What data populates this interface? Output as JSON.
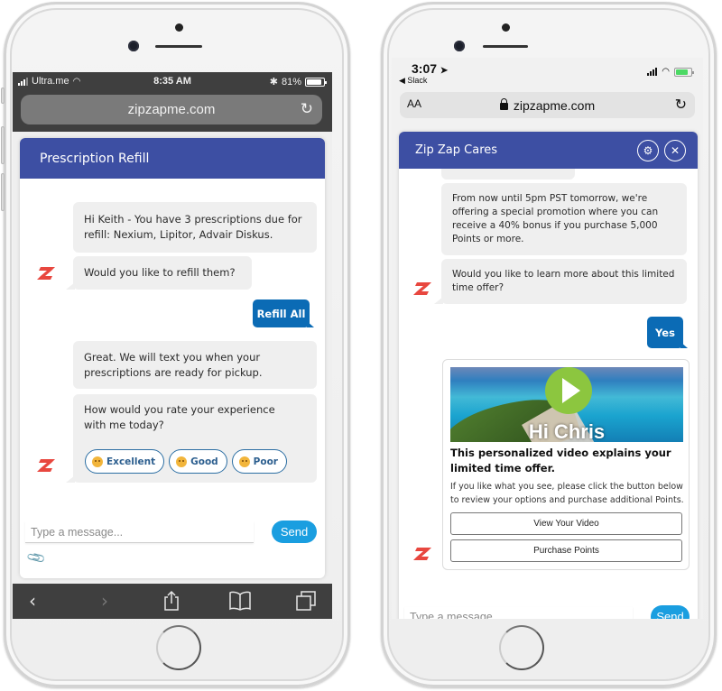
{
  "left_phone": {
    "status_bar": {
      "carrier": "Ultra.me",
      "time": "8:35 AM",
      "battery_percent": "81%",
      "battery_level": 0.81
    },
    "browser": {
      "url": "zipzapme.com",
      "reload_icon": "reload-icon"
    },
    "chat": {
      "title": "Prescription Refill",
      "messages": [
        {
          "from": "bot",
          "text": "Hi Keith - You have 3 prescriptions due for refill: Nexium, Lipitor, Advair Diskus."
        },
        {
          "from": "bot",
          "text": "Would you like to refill them?"
        },
        {
          "from": "user",
          "text": "Refill All"
        },
        {
          "from": "bot",
          "text": "Great. We will text you when your prescriptions are ready for pickup."
        },
        {
          "from": "bot",
          "text": "How would you rate your experience with me today?"
        }
      ],
      "rating_options": [
        {
          "label": "Excellent",
          "icon": "happy-face-icon"
        },
        {
          "label": "Good",
          "icon": "neutral-face-icon"
        },
        {
          "label": "Poor",
          "icon": "sad-face-icon"
        }
      ],
      "input_placeholder": "Type a message...",
      "send_label": "Send",
      "attach_icon": "paperclip-icon"
    },
    "toolbar": [
      "back-icon",
      "forward-icon",
      "share-icon",
      "bookmarks-icon",
      "tabs-icon"
    ]
  },
  "right_phone": {
    "status_bar": {
      "time": "3:07",
      "back_app": "◀ Slack"
    },
    "browser": {
      "text_size_label": "AA",
      "url": "zipzapme.com"
    },
    "chat": {
      "title": "Zip Zap Cares",
      "header_buttons": [
        "gear-icon",
        "close-icon"
      ],
      "messages": [
        {
          "from": "bot",
          "text": "From now until 5pm PST tomorrow, we're offering a special promotion where you can receive a 40% bonus if you purchase 5,000 Points or more."
        },
        {
          "from": "bot",
          "text": "Would you like to learn more about this limited time offer?"
        },
        {
          "from": "user",
          "text": "Yes"
        }
      ],
      "video_card": {
        "thumbnail_caption": "Hi Chris",
        "title": "This personalized video explains your limited time offer.",
        "body": "If you like what you see, please click the button below to review your options and purchase additional Points.",
        "buttons": [
          "View Your Video",
          "Purchase Points"
        ]
      },
      "input_placeholder": "Type a message...",
      "send_label": "Send"
    }
  },
  "colors": {
    "header_blue": "#3d4fa3",
    "user_bubble_blue": "#0b6bb5",
    "send_button_blue": "#1a9ee0",
    "logo_red": "#e8473f",
    "play_green": "#8cc63f"
  }
}
